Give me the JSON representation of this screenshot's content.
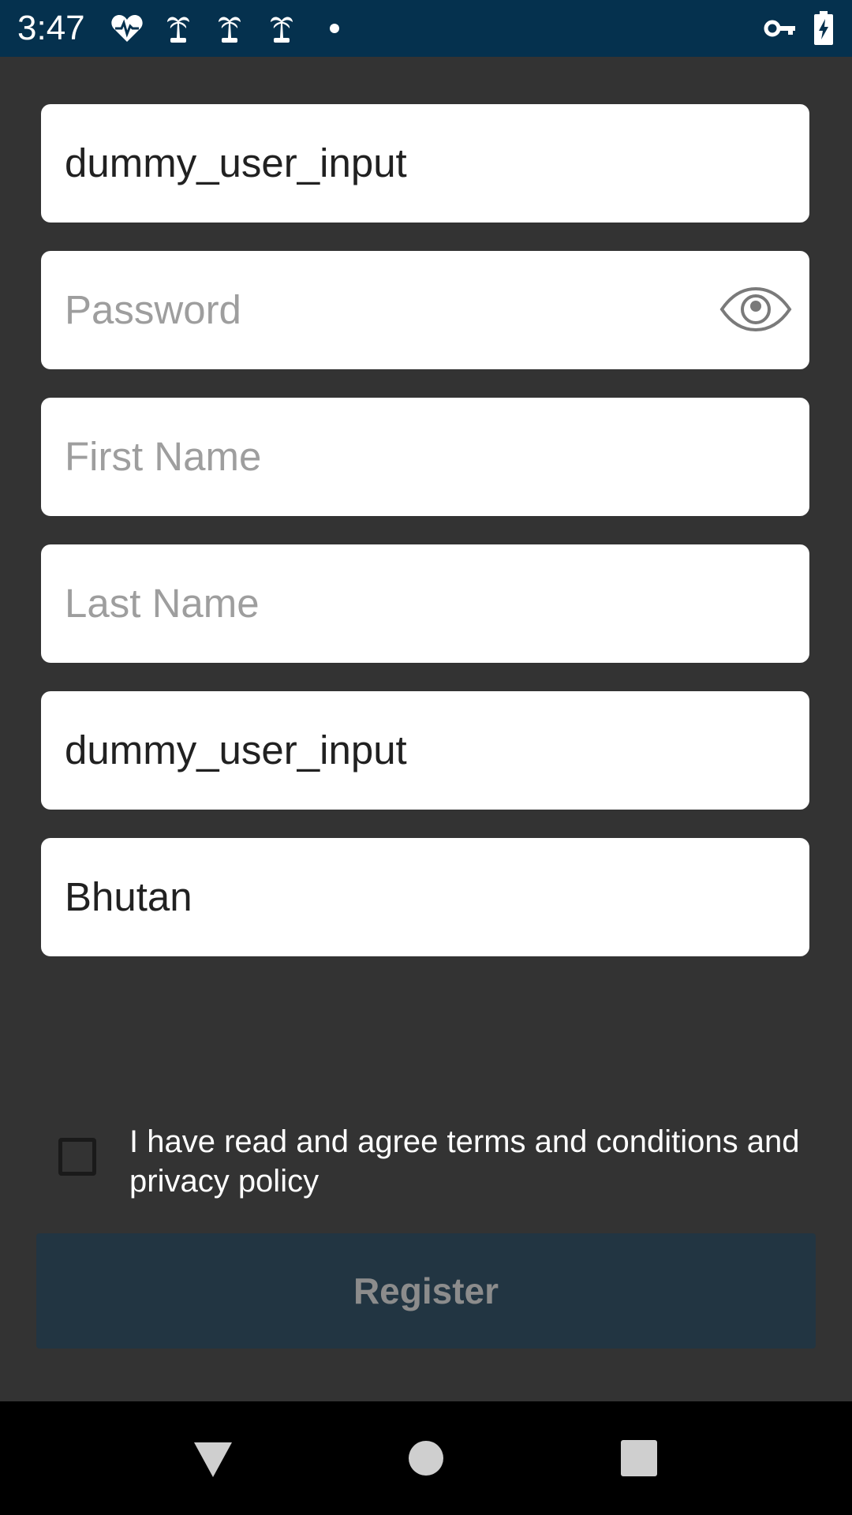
{
  "status_bar": {
    "time": "3:47",
    "icons": [
      "heart-monitor-icon",
      "palm-tree-icon",
      "palm-tree-icon",
      "palm-tree-icon",
      "dot-icon",
      "vpn-key-icon",
      "battery-charging-icon"
    ]
  },
  "form": {
    "username": {
      "value": "dummy_user_input"
    },
    "password": {
      "placeholder": "Password",
      "toggle_icon": "eye-icon"
    },
    "first_name": {
      "placeholder": "First Name"
    },
    "last_name": {
      "placeholder": "Last Name"
    },
    "email": {
      "value": "dummy_user_input"
    },
    "country": {
      "value": "Bhutan"
    }
  },
  "terms": {
    "label": "I have read and agree terms and conditions and privacy policy",
    "checked": false
  },
  "register": {
    "label": "Register",
    "enabled": false
  },
  "nav_bar": {
    "icons": [
      "back-icon",
      "home-icon",
      "recents-icon"
    ]
  },
  "colors": {
    "background": "#333333",
    "status_bar": "#05314e",
    "button": "#223542",
    "button_text": "#8c8c8c"
  }
}
